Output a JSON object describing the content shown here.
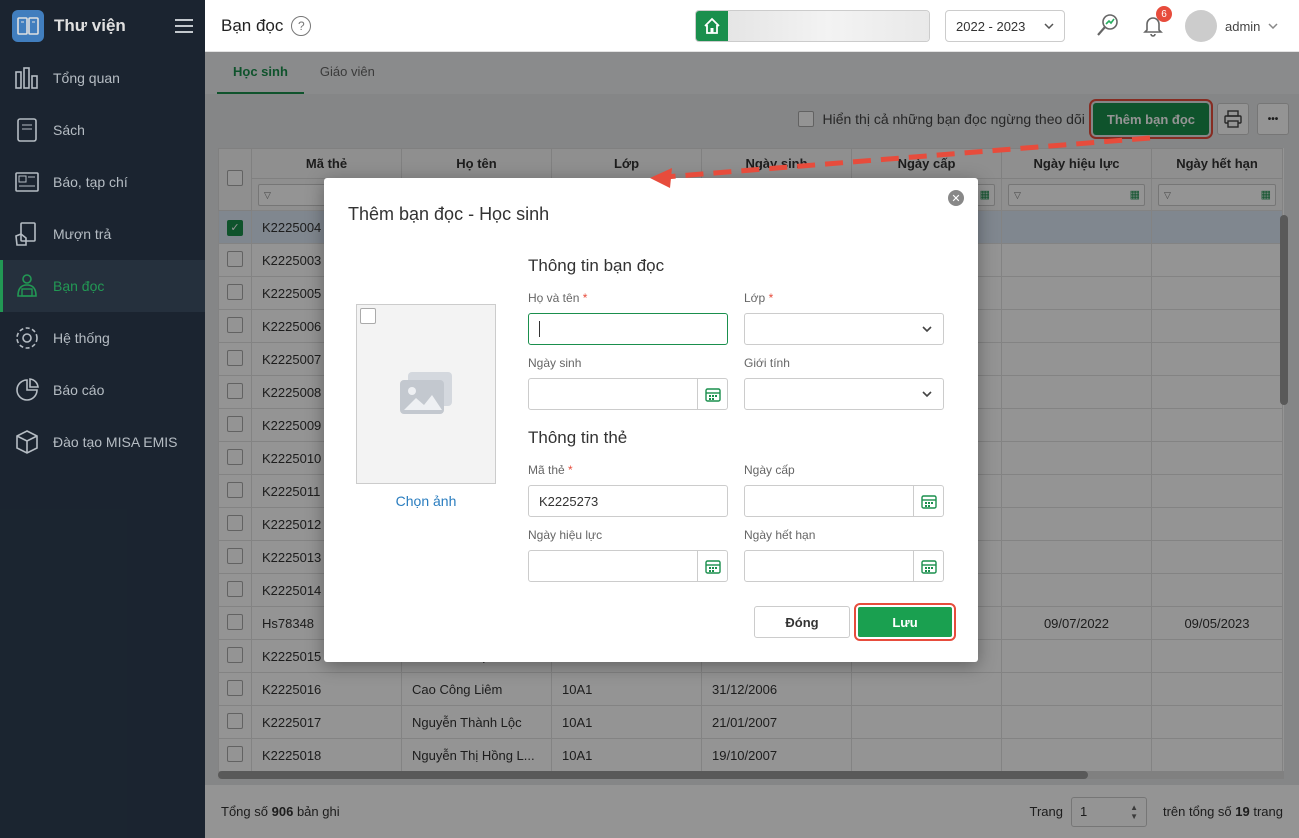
{
  "app": {
    "title": "Thư viện",
    "logo_text": "L"
  },
  "sidebar": {
    "items": [
      {
        "label": "Tổng quan",
        "icon": "chart-bars-icon"
      },
      {
        "label": "Sách",
        "icon": "book-icon"
      },
      {
        "label": "Báo, tạp chí",
        "icon": "newspaper-icon"
      },
      {
        "label": "Mượn trả",
        "icon": "borrow-icon"
      },
      {
        "label": "Bạn đọc",
        "icon": "reader-icon",
        "active": true
      },
      {
        "label": "Hệ thống",
        "icon": "gear-icon"
      },
      {
        "label": "Báo cáo",
        "icon": "pie-chart-icon"
      },
      {
        "label": "Đào tạo MISA EMIS",
        "icon": "cube-icon"
      }
    ]
  },
  "header": {
    "page_title": "Bạn đọc",
    "help": "?",
    "year": "2022 - 2023",
    "notifications": "6",
    "user": "admin"
  },
  "tabs": [
    {
      "label": "Học sinh"
    },
    {
      "label": "Giáo viên"
    }
  ],
  "toolbar": {
    "show_inactive_label": "Hiển thị cả những bạn đọc ngừng theo dõi",
    "add_label": "Thêm bạn đọc",
    "more": "•••"
  },
  "table": {
    "columns": [
      "Mã thẻ",
      "Họ tên",
      "Lớp",
      "Ngày sinh",
      "Ngày cấp",
      "Ngày hiệu lực",
      "Ngày hết hạn"
    ],
    "rows": [
      {
        "ma": "K2225004",
        "ten": "",
        "lop": "",
        "sinh": "",
        "cap": "",
        "hieuluc": "",
        "hethan": "",
        "sel": true
      },
      {
        "ma": "K2225003",
        "ten": "",
        "lop": "",
        "sinh": "",
        "cap": "",
        "hieuluc": "",
        "hethan": ""
      },
      {
        "ma": "K2225005",
        "ten": "",
        "lop": "",
        "sinh": "",
        "cap": "",
        "hieuluc": "",
        "hethan": ""
      },
      {
        "ma": "K2225006",
        "ten": "",
        "lop": "",
        "sinh": "",
        "cap": "",
        "hieuluc": "",
        "hethan": ""
      },
      {
        "ma": "K2225007",
        "ten": "",
        "lop": "",
        "sinh": "",
        "cap": "",
        "hieuluc": "",
        "hethan": ""
      },
      {
        "ma": "K2225008",
        "ten": "",
        "lop": "",
        "sinh": "",
        "cap": "",
        "hieuluc": "",
        "hethan": ""
      },
      {
        "ma": "K2225009",
        "ten": "",
        "lop": "",
        "sinh": "",
        "cap": "",
        "hieuluc": "",
        "hethan": ""
      },
      {
        "ma": "K2225010",
        "ten": "",
        "lop": "",
        "sinh": "",
        "cap": "",
        "hieuluc": "",
        "hethan": ""
      },
      {
        "ma": "K2225011",
        "ten": "",
        "lop": "",
        "sinh": "",
        "cap": "",
        "hieuluc": "",
        "hethan": ""
      },
      {
        "ma": "K2225012",
        "ten": "",
        "lop": "",
        "sinh": "",
        "cap": "",
        "hieuluc": "",
        "hethan": ""
      },
      {
        "ma": "K2225013",
        "ten": "",
        "lop": "",
        "sinh": "",
        "cap": "",
        "hieuluc": "",
        "hethan": ""
      },
      {
        "ma": "K2225014",
        "ten": "",
        "lop": "",
        "sinh": "",
        "cap": "",
        "hieuluc": "",
        "hethan": ""
      },
      {
        "ma": "Hs78348",
        "ten": "",
        "lop": "",
        "sinh": "",
        "cap": "",
        "hieuluc": "09/07/2022",
        "hethan": "09/05/2023"
      },
      {
        "ma": "K2225015",
        "ten": "Trần Văn Kiệt",
        "lop": "10A1",
        "sinh": "26/04/2007",
        "cap": "",
        "hieuluc": "",
        "hethan": ""
      },
      {
        "ma": "K2225016",
        "ten": "Cao Công Liêm",
        "lop": "10A1",
        "sinh": "31/12/2006",
        "cap": "",
        "hieuluc": "",
        "hethan": ""
      },
      {
        "ma": "K2225017",
        "ten": "Nguyễn Thành Lộc",
        "lop": "10A1",
        "sinh": "21/01/2007",
        "cap": "",
        "hieuluc": "",
        "hethan": ""
      },
      {
        "ma": "K2225018",
        "ten": "Nguyễn Thị Hồng L...",
        "lop": "10A1",
        "sinh": "19/10/2007",
        "cap": "",
        "hieuluc": "",
        "hethan": ""
      }
    ]
  },
  "footer": {
    "total_prefix": "Tổng số",
    "total": "906",
    "total_suffix": "bản ghi",
    "page_label": "Trang",
    "page": "1",
    "pages_prefix": "trên tổng số",
    "pages": "19",
    "pages_suffix": "trang"
  },
  "dialog": {
    "title": "Thêm bạn đọc - Học sinh",
    "choose_photo": "Chọn ảnh",
    "section_reader": "Thông tin bạn đọc",
    "section_card": "Thông tin thẻ",
    "full_name_label": "Họ và tên",
    "class_label": "Lớp",
    "dob_label": "Ngày sinh",
    "gender_label": "Giới tính",
    "card_no_label": "Mã thẻ",
    "card_no_value": "K2225273",
    "issue_label": "Ngày cấp",
    "valid_label": "Ngày hiệu lực",
    "expire_label": "Ngày hết hạn",
    "close_label": "Đóng",
    "save_label": "Lưu",
    "required": "*"
  },
  "colors": {
    "brand": "#1a8f4d",
    "highlight": "#e74c3c",
    "sidebar": "#1f2a37"
  }
}
